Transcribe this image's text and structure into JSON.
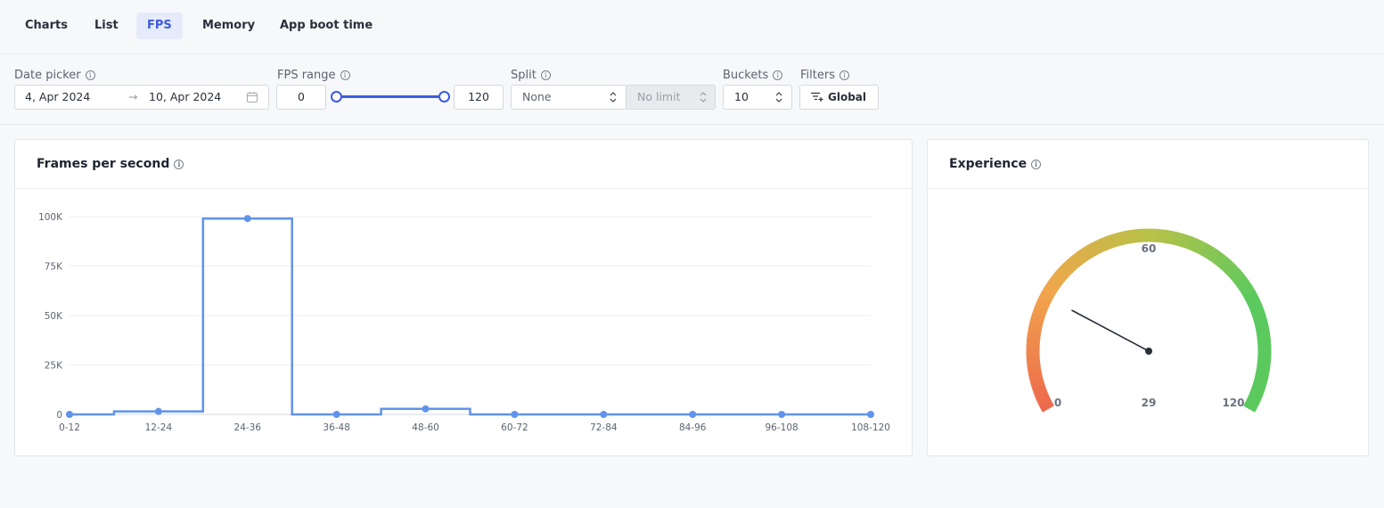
{
  "tabs": [
    {
      "label": "Charts"
    },
    {
      "label": "List"
    },
    {
      "label": "FPS"
    },
    {
      "label": "Memory"
    },
    {
      "label": "App boot time"
    }
  ],
  "active_tab": "FPS",
  "filters": {
    "date_picker": {
      "label": "Date picker",
      "start": "4, Apr 2024",
      "separator": "→",
      "end": "10, Apr 2024"
    },
    "fps_range": {
      "label": "FPS range",
      "min": "0",
      "max": "120",
      "low_fraction": 0,
      "high_fraction": 1
    },
    "split": {
      "label": "Split",
      "value": "None",
      "limit": "No limit"
    },
    "buckets": {
      "label": "Buckets",
      "value": "10"
    },
    "filters": {
      "label": "Filters",
      "button": "Global"
    }
  },
  "fps_card": {
    "title": "Frames per second"
  },
  "experience_card": {
    "title": "Experience"
  },
  "chart_data": [
    {
      "type": "line",
      "title": "Frames per second",
      "categories": [
        "0-12",
        "12-24",
        "24-36",
        "36-48",
        "48-60",
        "60-72",
        "72-84",
        "84-96",
        "96-108",
        "108-120"
      ],
      "values": [
        0,
        1500,
        99000,
        0,
        2800,
        0,
        0,
        0,
        0,
        0
      ],
      "yticks": [
        "0",
        "25K",
        "50K",
        "75K",
        "100K"
      ],
      "ytick_values": [
        0,
        25000,
        50000,
        75000,
        100000
      ],
      "ylim": [
        0,
        100000
      ],
      "step": true,
      "color": "#6193ea",
      "grid": true
    },
    {
      "type": "gauge",
      "title": "Experience",
      "min": 0,
      "mid": 60,
      "max": 120,
      "value": 29,
      "labels": {
        "min": "0",
        "mid": "60",
        "max": "120",
        "value": "29"
      },
      "colors": [
        "#ee6a4d",
        "#f0a64c",
        "#b6c248",
        "#5cc95f"
      ]
    }
  ],
  "colors": {
    "accent": "#3d5be0",
    "line": "#6193ea"
  }
}
